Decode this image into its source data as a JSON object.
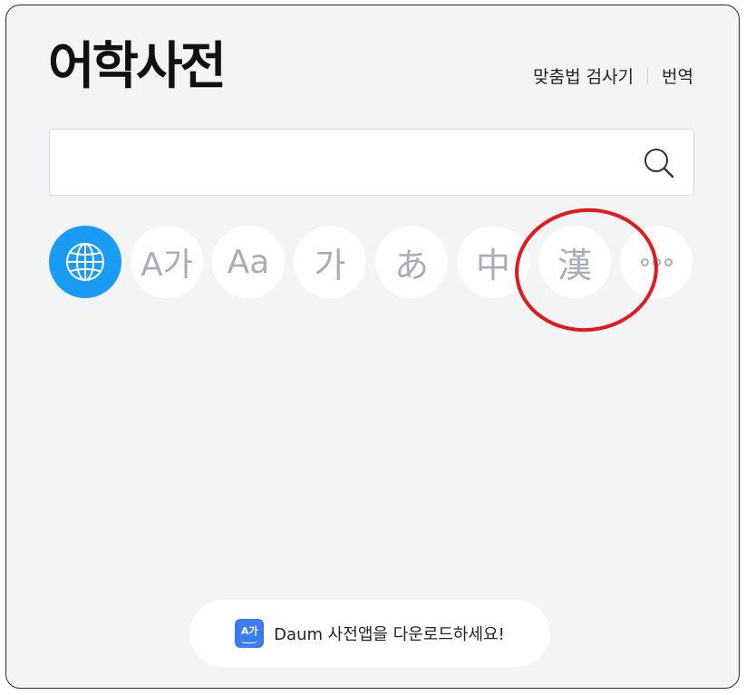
{
  "header": {
    "title": "어학사전",
    "links": [
      "맞춤법 검사기",
      "번역"
    ]
  },
  "search": {
    "value": "",
    "placeholder": ""
  },
  "languages": [
    {
      "name": "all-languages",
      "label": "",
      "icon": "globe-icon",
      "active": true
    },
    {
      "name": "english-korean",
      "label": "A가",
      "active": false
    },
    {
      "name": "english",
      "label": "Aa",
      "active": false
    },
    {
      "name": "korean",
      "label": "가",
      "active": false
    },
    {
      "name": "japanese",
      "label": "あ",
      "active": false
    },
    {
      "name": "chinese",
      "label": "中",
      "active": false
    },
    {
      "name": "hanja",
      "label": "漢",
      "active": false
    },
    {
      "name": "more",
      "label": "",
      "icon": "more-dots-icon",
      "active": false
    }
  ],
  "banner": {
    "icon_text": "A가",
    "text": "Daum 사전앱을 다운로드하세요!"
  },
  "colors": {
    "background": "#f3f4f6",
    "active": "#1a9bf5",
    "inactive_glyph": "#a8aeb6",
    "annotation": "#e01a1a",
    "app_icon": "#3d7bf0"
  }
}
